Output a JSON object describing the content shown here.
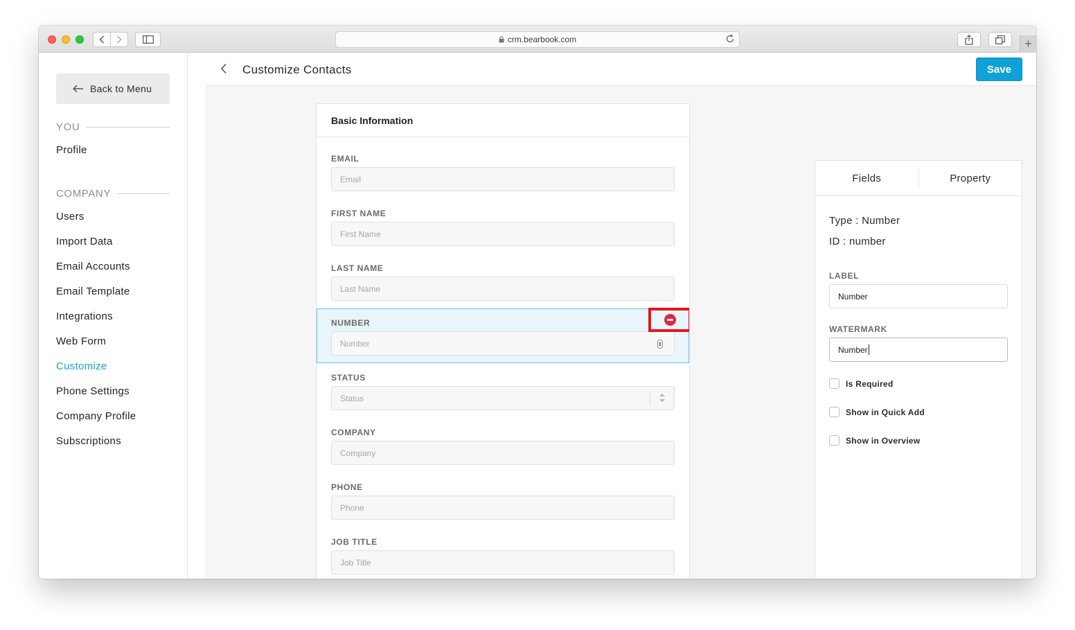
{
  "browser": {
    "url": "crm.bearbook.com"
  },
  "sidebar": {
    "back_label": "Back to Menu",
    "you_heading": "YOU",
    "you_items": [
      {
        "label": "Profile"
      }
    ],
    "company_heading": "COMPANY",
    "company_items": [
      {
        "label": "Users"
      },
      {
        "label": "Import Data"
      },
      {
        "label": "Email Accounts"
      },
      {
        "label": "Email Template"
      },
      {
        "label": "Integrations"
      },
      {
        "label": "Web Form"
      },
      {
        "label": "Customize",
        "active": true
      },
      {
        "label": "Phone Settings"
      },
      {
        "label": "Company Profile"
      },
      {
        "label": "Subscriptions"
      }
    ]
  },
  "header": {
    "title": "Customize Contacts",
    "save_label": "Save"
  },
  "form": {
    "section_title": "Basic Information",
    "fields": [
      {
        "label": "EMAIL",
        "placeholder": "Email"
      },
      {
        "label": "FIRST NAME",
        "placeholder": "First Name"
      },
      {
        "label": "LAST NAME",
        "placeholder": "Last Name"
      },
      {
        "label": "NUMBER",
        "placeholder": "Number",
        "selected": true
      },
      {
        "label": "STATUS",
        "placeholder": "Status"
      },
      {
        "label": "COMPANY",
        "placeholder": "Company"
      },
      {
        "label": "PHONE",
        "placeholder": "Phone"
      },
      {
        "label": "JOB TITLE",
        "placeholder": "Job Title"
      }
    ]
  },
  "panel": {
    "tabs": [
      {
        "label": "Fields"
      },
      {
        "label": "Property"
      }
    ],
    "type_text": "Type : Number",
    "id_text": "ID : number",
    "label_heading": "LABEL",
    "label_value": "Number",
    "watermark_heading": "WATERMARK",
    "watermark_value": "Number",
    "checkboxes": [
      {
        "label": "Is Required",
        "checked": false
      },
      {
        "label": "Show in Quick Add",
        "checked": false
      },
      {
        "label": "Show in Overview",
        "checked": false
      }
    ]
  },
  "colors": {
    "accent": "#11a1d9",
    "active_nav": "#12a7cf",
    "selected_field_bg": "#e8f5fb",
    "highlight": "#e8141c"
  }
}
